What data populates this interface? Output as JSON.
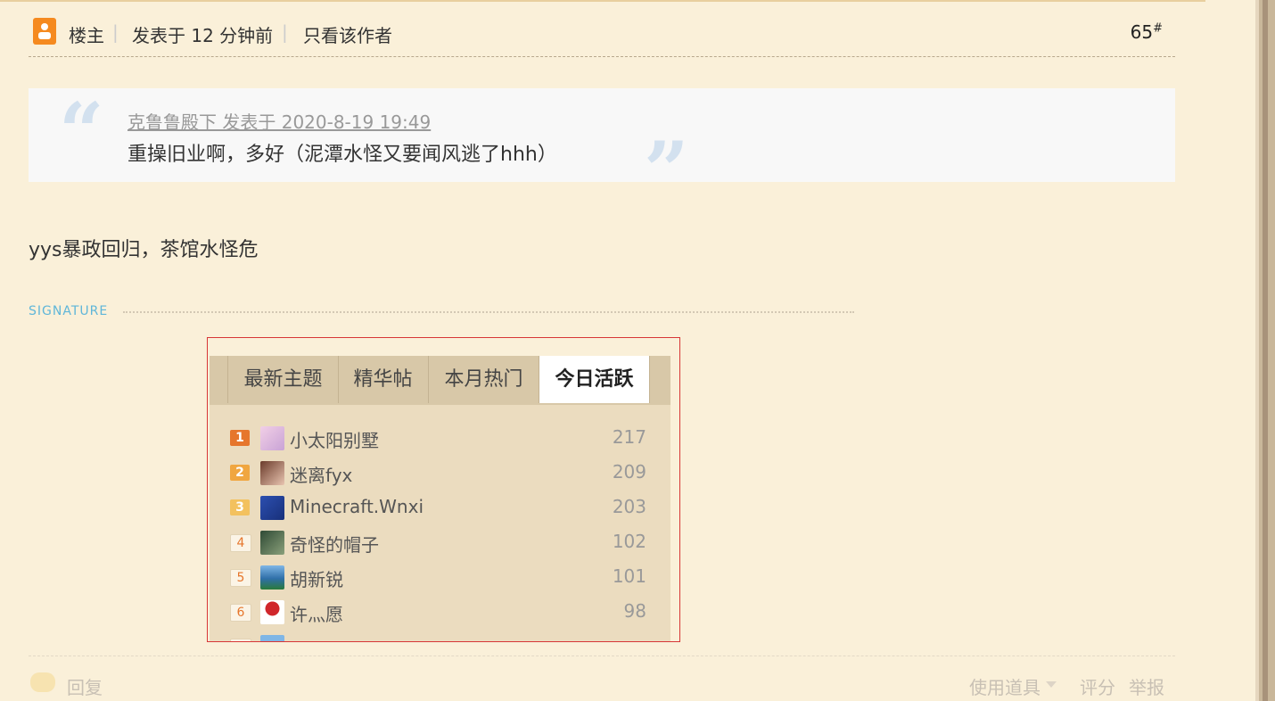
{
  "header": {
    "owner_label": "楼主",
    "posted_time": "发表于 12 分钟前",
    "only_author": "只看该作者",
    "floor_number": "65",
    "floor_mark": "#"
  },
  "quote": {
    "meta": "克鲁鲁殿下 发表于 2020-8-19 19:49",
    "text": "重操旧业啊，多好（泥潭水怪又要闻风逃了hhh）"
  },
  "post": {
    "text": "yys暴政回归，茶馆水怪危"
  },
  "signature": {
    "label": "SIGNATURE",
    "tabs": [
      "最新主题",
      "精华帖",
      "本月热门",
      "今日活跃"
    ],
    "active_tab": "今日活跃",
    "ranking": [
      {
        "rank": "1",
        "name": "小太阳别墅",
        "count": "217"
      },
      {
        "rank": "2",
        "name": "迷离fyx",
        "count": "209"
      },
      {
        "rank": "3",
        "name": "Minecraft.Wnxi",
        "count": "203"
      },
      {
        "rank": "4",
        "name": "奇怪的帽子",
        "count": "102"
      },
      {
        "rank": "5",
        "name": "胡新锐",
        "count": "101"
      },
      {
        "rank": "6",
        "name": "许灬愿",
        "count": "98"
      }
    ]
  },
  "footer": {
    "reply": "回复",
    "use_tool": "使用道具",
    "rate": "评分",
    "report": "举报"
  },
  "colors": {
    "background": "#faf0d9",
    "accent_orange": "#f58a1f",
    "signature_blue": "#5fb6d9"
  }
}
